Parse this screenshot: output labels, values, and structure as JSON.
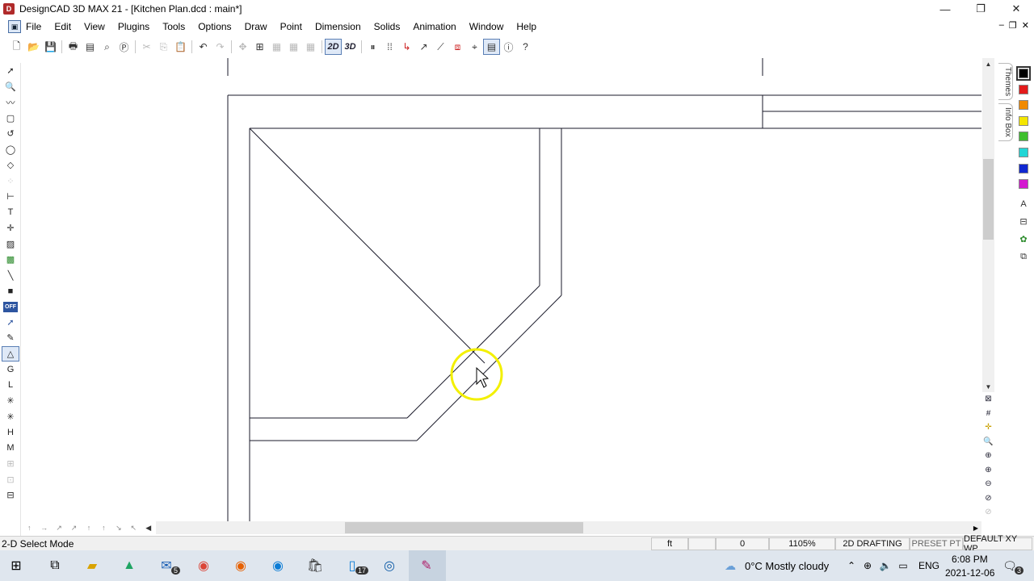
{
  "window": {
    "title": "DesignCAD 3D MAX 21 - [Kitchen Plan.dcd : main*]",
    "app_icon": "designcad-icon",
    "minimize": "—",
    "maximize": "❐",
    "close": "✕"
  },
  "menubar": {
    "items": [
      "File",
      "Edit",
      "View",
      "Plugins",
      "Tools",
      "Options",
      "Draw",
      "Point",
      "Dimension",
      "Solids",
      "Animation",
      "Window",
      "Help"
    ],
    "doc_minimize": "–",
    "doc_restore": "❐",
    "doc_close": "✕"
  },
  "toolbar": {
    "mode_2d": "2D",
    "mode_3d": "3D"
  },
  "left_palette": {
    "off_label": "OFF"
  },
  "side_tabs": {
    "themes": "Themes",
    "info_box": "Info Box"
  },
  "colors": {
    "swatches": [
      "#000000",
      "#e31b1b",
      "#f08a00",
      "#f4e600",
      "#3fbf2f",
      "#22d6d6",
      "#1028d0",
      "#d41ad0"
    ],
    "accent": "#2d55a0",
    "cursor_highlight": "#f3f000"
  },
  "statusbar": {
    "mode": "2-D Select Mode",
    "unit": "ft",
    "value": "0",
    "zoom": "1105%",
    "drafting": "2D DRAFTING",
    "preset": "PRESET PT",
    "plane": "DEFAULT XY WP"
  },
  "taskbar": {
    "weather": "0°C  Mostly cloudy",
    "lang": "ENG",
    "time": "6:08 PM",
    "date": "2021-12-06",
    "mail_badge": "5",
    "files_badge": "17",
    "notif_badge": "3"
  }
}
